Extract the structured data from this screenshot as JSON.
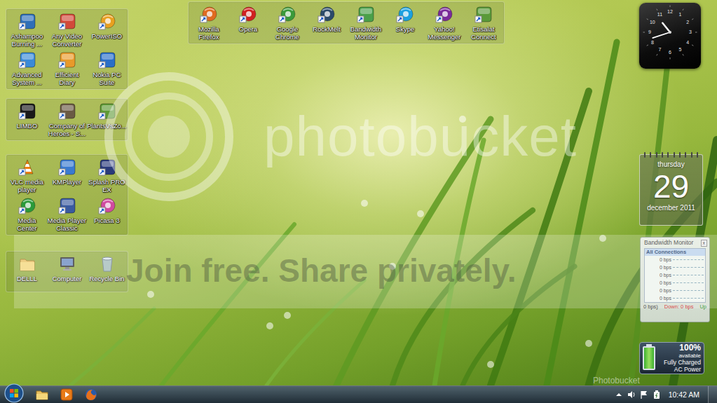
{
  "fences": [
    {
      "items": [
        {
          "label": "Ashampoo Burning ...",
          "kind": "app",
          "color": "#2f6fb8"
        },
        {
          "label": "Any Video Converter",
          "kind": "app",
          "color": "#d24a3a"
        },
        {
          "label": "PowerISO",
          "kind": "disc",
          "color": "#e8a020"
        },
        {
          "label": "Advanced System ...",
          "kind": "app",
          "color": "#3a8ad8"
        },
        {
          "label": "Efficient Diary",
          "kind": "app",
          "color": "#e89a2a"
        },
        {
          "label": "Nokia PC Suite",
          "kind": "app",
          "color": "#2a6fc8"
        }
      ]
    },
    {
      "items": [
        {
          "label": "LIMBO",
          "kind": "app",
          "color": "#1a1a1a"
        },
        {
          "label": "Company of Heroes - S...",
          "kind": "app",
          "color": "#6a5a44"
        },
        {
          "label": "PlantsVsZo...",
          "kind": "app",
          "color": "#5e9a34"
        }
      ]
    },
    {
      "items": [
        {
          "label": "VLC media player",
          "kind": "cone",
          "color": "#f08010"
        },
        {
          "label": "KMPlayer",
          "kind": "app",
          "color": "#3a7ad0"
        },
        {
          "label": "Splash PRO EX",
          "kind": "app",
          "color": "#2a3a7a"
        },
        {
          "label": "Media Center",
          "kind": "disc",
          "color": "#2a9a3a"
        },
        {
          "label": "Media Player Classic",
          "kind": "app",
          "color": "#3a5aa0"
        },
        {
          "label": "Picasa 3",
          "kind": "disc",
          "color": "#d04aa0"
        }
      ]
    },
    {
      "items": [
        {
          "label": "DELLL",
          "kind": "folder",
          "color": "#e8c060"
        },
        {
          "label": "Computer",
          "kind": "computer",
          "color": "#6a8ac0"
        },
        {
          "label": "Recycle Bin",
          "kind": "bin",
          "color": "#a8c0d8"
        }
      ]
    },
    {
      "items": [
        {
          "label": "Mozilla Firefox",
          "kind": "disc",
          "color": "#e06a20"
        },
        {
          "label": "Opera",
          "kind": "disc",
          "color": "#d02020"
        },
        {
          "label": "Google Chrome",
          "kind": "disc",
          "color": "#3a9a3a"
        },
        {
          "label": "RockMelt",
          "kind": "disc",
          "color": "#2a4a6a"
        },
        {
          "label": "Bandwidth Monitor",
          "kind": "app",
          "color": "#4aa04a"
        },
        {
          "label": "Skype",
          "kind": "disc",
          "color": "#1aa0e0"
        },
        {
          "label": "Yahoo! Messenger",
          "kind": "disc",
          "color": "#7a2a9a"
        },
        {
          "label": "Etisalat Connect",
          "kind": "app",
          "color": "#5a9a3a"
        }
      ]
    }
  ],
  "clock": {
    "numerals": [
      "12",
      "1",
      "2",
      "3",
      "4",
      "5",
      "6",
      "7",
      "8",
      "9",
      "10",
      "11"
    ],
    "hour": 10,
    "minute": 42
  },
  "calendar": {
    "day": "thursday",
    "date": "29",
    "month": "december 2011"
  },
  "bandwidth": {
    "title": "Bandwidth Monitor",
    "close": "x",
    "header": "All Connections",
    "rows": [
      "0 bps",
      "0 bps",
      "0 bps",
      "0 bps",
      "0 bps",
      "0 bps"
    ],
    "footer": [
      {
        "text": "0 bps)",
        "color": "#222222"
      },
      {
        "text": "Down: 0 bps",
        "color": "#cc1111"
      },
      {
        "text": "Up",
        "color": "#118811"
      }
    ]
  },
  "battery": {
    "percent": "100%",
    "available": "available",
    "status": "Fully Charged",
    "source": "AC Power",
    "level": 1
  },
  "watermark": {
    "brand": "photobucket",
    "slogan": "Join free. Share privately.",
    "corner": "Photobucket"
  },
  "taskbar": {
    "pinned": [
      {
        "kind": "folder"
      },
      {
        "kind": "media"
      },
      {
        "kind": "browser"
      }
    ],
    "tray": [
      {
        "kind": "up"
      },
      {
        "kind": "volume"
      },
      {
        "kind": "flag"
      },
      {
        "kind": "power"
      }
    ],
    "time": "10:42 AM"
  }
}
